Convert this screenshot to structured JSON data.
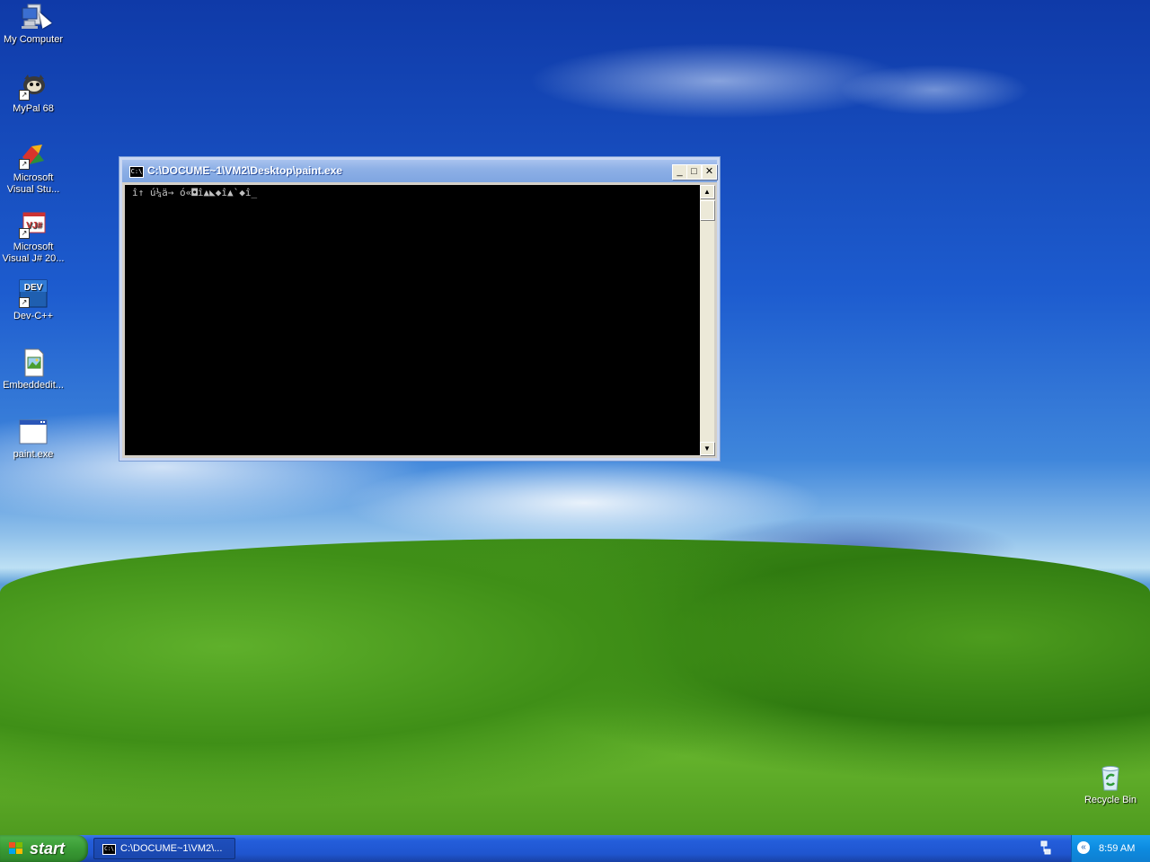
{
  "desktop": {
    "icons": [
      {
        "label": "My Computer",
        "icon": "my-computer-icon"
      },
      {
        "label": "MyPal 68",
        "icon": "mypal-browser-icon"
      },
      {
        "label": "Microsoft Visual Stu...",
        "icon": "visual-studio-icon"
      },
      {
        "label": "Microsoft Visual J# 20...",
        "icon": "visual-jsharp-icon"
      },
      {
        "label": "Dev-C++",
        "icon": "dev-cpp-icon"
      },
      {
        "label": "Embeddedit...",
        "icon": "embedded-image-file-icon"
      },
      {
        "label": "paint.exe",
        "icon": "program-window-icon"
      },
      {
        "label": "Recycle Bin",
        "icon": "recycle-bin-icon"
      }
    ],
    "dev_icon_text": "DEV",
    "vj_icon_text": "VJ#"
  },
  "console": {
    "title": "C:\\DOCUME~1\\VM2\\Desktop\\paint.exe",
    "sys_icon_text": "C:\\",
    "output": "î↑ ú¼ä→ ó«◘î▲◣◆î▲`◆î_",
    "minimize": "_",
    "maximize": "□",
    "close": "✕",
    "scroll_up": "▲",
    "scroll_down": "▼"
  },
  "taskbar": {
    "start_label": "start",
    "task_label": "C:\\DOCUME~1\\VM2\\...",
    "task_icon_text": "C:\\",
    "clock": "8:59 AM"
  },
  "colors": {
    "titlebar": "#8eb0e6",
    "taskbar": "#245edb",
    "start_button": "#3a9b35",
    "tray": "#0d8be0",
    "console_bg": "#000000"
  }
}
